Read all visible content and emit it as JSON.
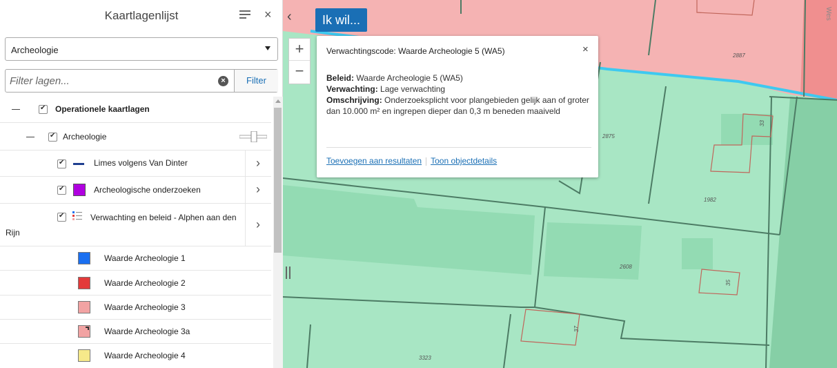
{
  "sidebar": {
    "title": "Kaartlagenlijst",
    "close_icon": "×",
    "theme_select": {
      "value": "Archeologie"
    },
    "filter": {
      "placeholder": "Filter lagen...",
      "clear_icon": "×",
      "button_label": "Filter"
    },
    "tree": {
      "root": {
        "label": "Operationele kaartlagen"
      },
      "group": {
        "label": "Archeologie"
      },
      "layers": [
        {
          "label": "Limes volgens Van Dinter",
          "chevron": "›",
          "symbol_color": "#1f3f8f"
        },
        {
          "label": "Archeologische onderzoeken",
          "chevron": "›",
          "symbol_color": "#b000e0"
        },
        {
          "label": "Verwachting en beleid - Alphen aan den Rijn",
          "chevron": "›"
        }
      ],
      "legend": [
        {
          "label": "Waarde Archeologie 1",
          "color": "#1a6ff0"
        },
        {
          "label": "Waarde Archeologie 2",
          "color": "#e33a3a"
        },
        {
          "label": "Waarde Archeologie 3",
          "color": "#f2a3a3"
        },
        {
          "label": "Waarde Archeologie 3a",
          "color": "#f2a3a3"
        },
        {
          "label": "Waarde Archeologie 4",
          "color": "#f6e98a"
        }
      ]
    }
  },
  "map": {
    "collapse_icon": "‹",
    "ik_wil_label": "Ik wil...",
    "zoom_in": "+",
    "zoom_out": "−",
    "parcel_labels": [
      "2887",
      "2875",
      "1982",
      "2608",
      "3323",
      "33",
      "35",
      "37"
    ],
    "street_label": "Wes",
    "popup": {
      "title": "Verwachtingscode: Waarde Archeologie 5 (WA5)",
      "close_icon": "×",
      "beleid_key": "Beleid:",
      "beleid_val": "Waarde Archeologie 5 (WA5)",
      "verwachting_key": "Verwachting:",
      "verwachting_val": "Lage verwachting",
      "omschrijving_key": "Omschrijving:",
      "omschrijving_val": "Onderzoeksplicht voor plangebieden gelijk aan of groter dan 10.000 m² en ingrepen dieper dan 0,3 m beneden maaiveld",
      "link_add": "Toevoegen aan resultaten",
      "link_details": "Toon objectdetails"
    }
  },
  "colors": {
    "accent": "#1a6fb5",
    "wa5_fill": "#a8e6c4",
    "wa3_fill": "#f5b3b3",
    "limes_line": "#3ec9f0"
  }
}
